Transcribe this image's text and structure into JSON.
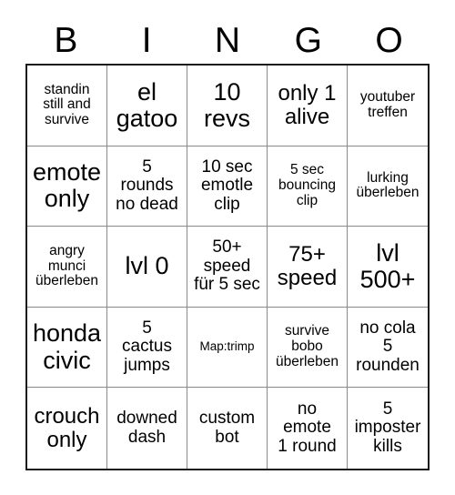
{
  "card": {
    "headers": [
      "B",
      "I",
      "N",
      "G",
      "O"
    ],
    "colors": {
      "outer_border": "#1a1a1a",
      "inner_border": "#8a8a8a",
      "background": "#ffffff",
      "text": "#000000"
    },
    "rows": [
      [
        {
          "text": "standin\nstill and\nsurvive",
          "size": "fs-sm"
        },
        {
          "text": "el\ngatoo",
          "size": "fs-xl"
        },
        {
          "text": "10\nrevs",
          "size": "fs-xl"
        },
        {
          "text": "only 1\nalive",
          "size": "fs-lg"
        },
        {
          "text": "youtuber\ntreffen",
          "size": "fs-sm"
        }
      ],
      [
        {
          "text": "emote\nonly",
          "size": "fs-xl"
        },
        {
          "text": "5\nrounds\nno dead",
          "size": "fs-md"
        },
        {
          "text": "10 sec\nemotle\nclip",
          "size": "fs-md"
        },
        {
          "text": "5 sec\nbouncing\nclip",
          "size": "fs-sm"
        },
        {
          "text": "lurking\nüberleben",
          "size": "fs-sm"
        }
      ],
      [
        {
          "text": "angry\nmunci\nüberleben",
          "size": "fs-sm"
        },
        {
          "text": "lvl 0",
          "size": "fs-xl"
        },
        {
          "text": "50+\nspeed\nfür 5 sec",
          "size": "fs-md"
        },
        {
          "text": "75+\nspeed",
          "size": "fs-lg"
        },
        {
          "text": "lvl\n500+",
          "size": "fs-xl"
        }
      ],
      [
        {
          "text": "honda\ncivic",
          "size": "fs-xl"
        },
        {
          "text": "5\ncactus\njumps",
          "size": "fs-md"
        },
        {
          "text": "Map:trimp",
          "size": "fs-xs"
        },
        {
          "text": "survive\nbobo\nüberleben",
          "size": "fs-sm"
        },
        {
          "text": "no cola\n5\nrounden",
          "size": "fs-md"
        }
      ],
      [
        {
          "text": "crouch\nonly",
          "size": "fs-lg"
        },
        {
          "text": "downed\ndash",
          "size": "fs-md"
        },
        {
          "text": "custom\nbot",
          "size": "fs-md"
        },
        {
          "text": "no\nemote\n1 round",
          "size": "fs-md"
        },
        {
          "text": "5\nimposter\nkills",
          "size": "fs-md"
        }
      ]
    ]
  }
}
